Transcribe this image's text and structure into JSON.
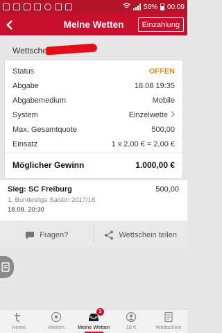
{
  "statusbar": {
    "battery": "56%",
    "time": "00:09"
  },
  "header": {
    "title": "Meine Wetten",
    "einzahlung": "Einzahlung"
  },
  "ticket": {
    "label": "Wettschein",
    "rows": [
      {
        "label": "Status",
        "value": "OFFEN"
      },
      {
        "label": "Abgabe",
        "value": "18.08 19:35"
      },
      {
        "label": "Abgabemedium",
        "value": "Mobile"
      },
      {
        "label": "System",
        "value": "Einzelwette"
      },
      {
        "label": "Max. Gesamtquote",
        "value": "500,00"
      },
      {
        "label": "Einsatz",
        "value": "1 x 2,00 € = 2,00 €"
      }
    ],
    "gain_label": "Möglicher Gewinn",
    "gain_value": "1.000,00 €"
  },
  "bet": {
    "team": "Sieg: SC Freiburg",
    "amount": "500,00",
    "league": "1. Bundesliga Saison 2017/18",
    "date": "18.08. 20:30"
  },
  "actions": {
    "fragen": "Fragen?",
    "teilen": "Wettschein teilen"
  },
  "nav": [
    {
      "label": "Home"
    },
    {
      "label": "Wetten"
    },
    {
      "label": "Meine Wetten",
      "badge": "3"
    },
    {
      "label": "16 €"
    },
    {
      "label": "Wettschein"
    }
  ],
  "colors": {
    "primary": "#c8102e",
    "status_open": "#e08a1e"
  }
}
